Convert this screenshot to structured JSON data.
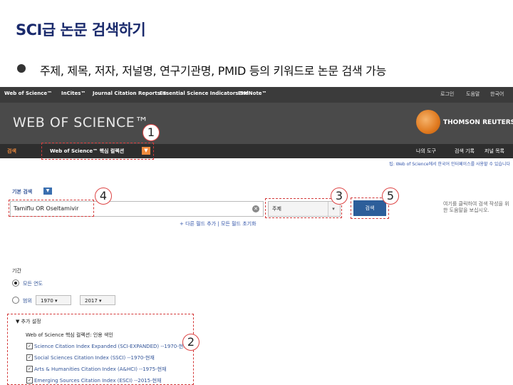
{
  "slide": {
    "title": "SCI급 논문 검색하기",
    "bullet": "주제, 제목, 저자, 저널명, 연구기관명, PMID 등의 키워드로 논문 검색 가능"
  },
  "wos": {
    "top_links": [
      "Web of Science™",
      "InCites™",
      "Journal Citation Reports ®",
      "Essential Science Indicators SM",
      "EndNote™"
    ],
    "top_right": [
      "로그인",
      "도움말",
      "한국어"
    ],
    "logo": "WEB OF SCIENCE™",
    "publisher": "THOMSON REUTERS™",
    "nav_search_tab": "검색",
    "nav_database": "Web of Science™ 핵심 컬렉션",
    "nav_right": [
      "나의 도구",
      "검색 기록",
      "저널 목록"
    ],
    "notice": "팁: Web of Science에서 한국어 인터페이스를 사용할 수 있습니다",
    "basic_search_label": "기본 검색",
    "search_value": "Tamiflu OR Oseltamivir",
    "field_value": "주제",
    "search_button": "검색",
    "side_note": "여기를 클릭하여 검색 작성을 위한 도움말을 보십시오.",
    "field_links": [
      "+ 다른 필드 추가",
      "모든 필드 초기화"
    ],
    "period_label": "기간",
    "period_options": [
      "모든 연도",
      "범위"
    ],
    "year_from": "1970",
    "year_to": "2017",
    "more_settings": "▼ 추가 설정",
    "collection_title": "Web of Science 핵심 컬렉션: 인용 색인",
    "indexes": [
      "Science Citation Index Expanded (SCI-EXPANDED) --1970-현재",
      "Social Sciences Citation Index (SSCI) --1970-현재",
      "Arts & Humanities Citation Index (A&HCI) --1975-현재",
      "Emerging Sources Citation Index (ESCI) --2015-현재"
    ]
  },
  "markers": [
    "1",
    "2",
    "3",
    "4",
    "5"
  ],
  "colors": {
    "accent": "#f08a3c",
    "annotation": "#d43a3a",
    "button": "#2d5e9a"
  }
}
